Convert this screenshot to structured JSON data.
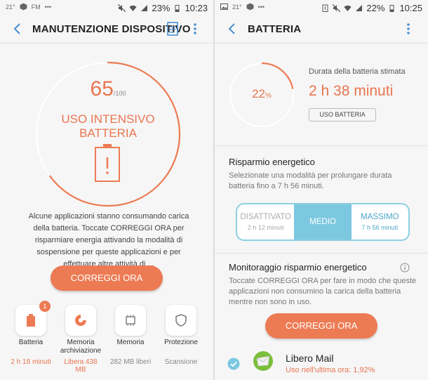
{
  "left": {
    "status": {
      "temp": "21°",
      "fm": "FM",
      "battery": "23%",
      "time": "10:23"
    },
    "title": "MANUTENZIONE DISPOSITIVO",
    "score": "65",
    "score_max": "/100",
    "ring_text_1": "USO INTENSIVO",
    "ring_text_2": "BATTERIA",
    "description": "Alcune applicazioni stanno consumando carica della batteria. Toccate CORREGGI ORA per risparmiare energia attivando la modalità di sospensione per queste applicazioni e per effettuare altre attività di ...",
    "fix_button": "CORREGGI ORA",
    "tiles": [
      {
        "label": "Batteria",
        "value": "2 h 18 minuti",
        "badge": "1",
        "icon": "battery-icon"
      },
      {
        "label": "Memoria archiviazione",
        "value": "Libera 438 MB",
        "icon": "storage-pie-icon"
      },
      {
        "label": "Memoria",
        "value": "282 MB liberi",
        "icon": "memory-chip-icon"
      },
      {
        "label": "Protezione",
        "value": "Scansione",
        "icon": "shield-icon"
      }
    ],
    "score_fraction": 0.65
  },
  "right": {
    "status": {
      "temp": "21°",
      "battery": "22%",
      "time": "10:25"
    },
    "title": "BATTERIA",
    "battery_pct": "22",
    "battery_pct_unit": "%",
    "battery_fraction": 0.22,
    "duration_label": "Durata della batteria stimata",
    "duration_value": "2 h 38 minuti",
    "usage_button": "USO BATTERIA",
    "saving_title": "Risparmio energetico",
    "saving_sub": "Selezionate una modalità per prolungare durata batteria fino a 7 h 56 minuti.",
    "modes": [
      {
        "name": "DISATTIVATO",
        "time": "2 h 12 minuti"
      },
      {
        "name": "MEDIO",
        "time": ""
      },
      {
        "name": "MASSIMO",
        "time": "7 h 56 minuti"
      }
    ],
    "monitor_title": "Monitoraggio risparmio energetico",
    "monitor_sub": "Toccate CORREGGI ORA per fare in modo che queste applicazioni non consumino la carica della batteria mentre non sono in uso.",
    "fix_button": "CORREGGI ORA",
    "app_name": "Libero Mail",
    "app_usage": "Uso nell'ultima ora: 1,92%"
  },
  "colors": {
    "accent": "#ec7b54",
    "seg_active": "#7cc8e0",
    "seg_border": "#8ccfe3"
  }
}
